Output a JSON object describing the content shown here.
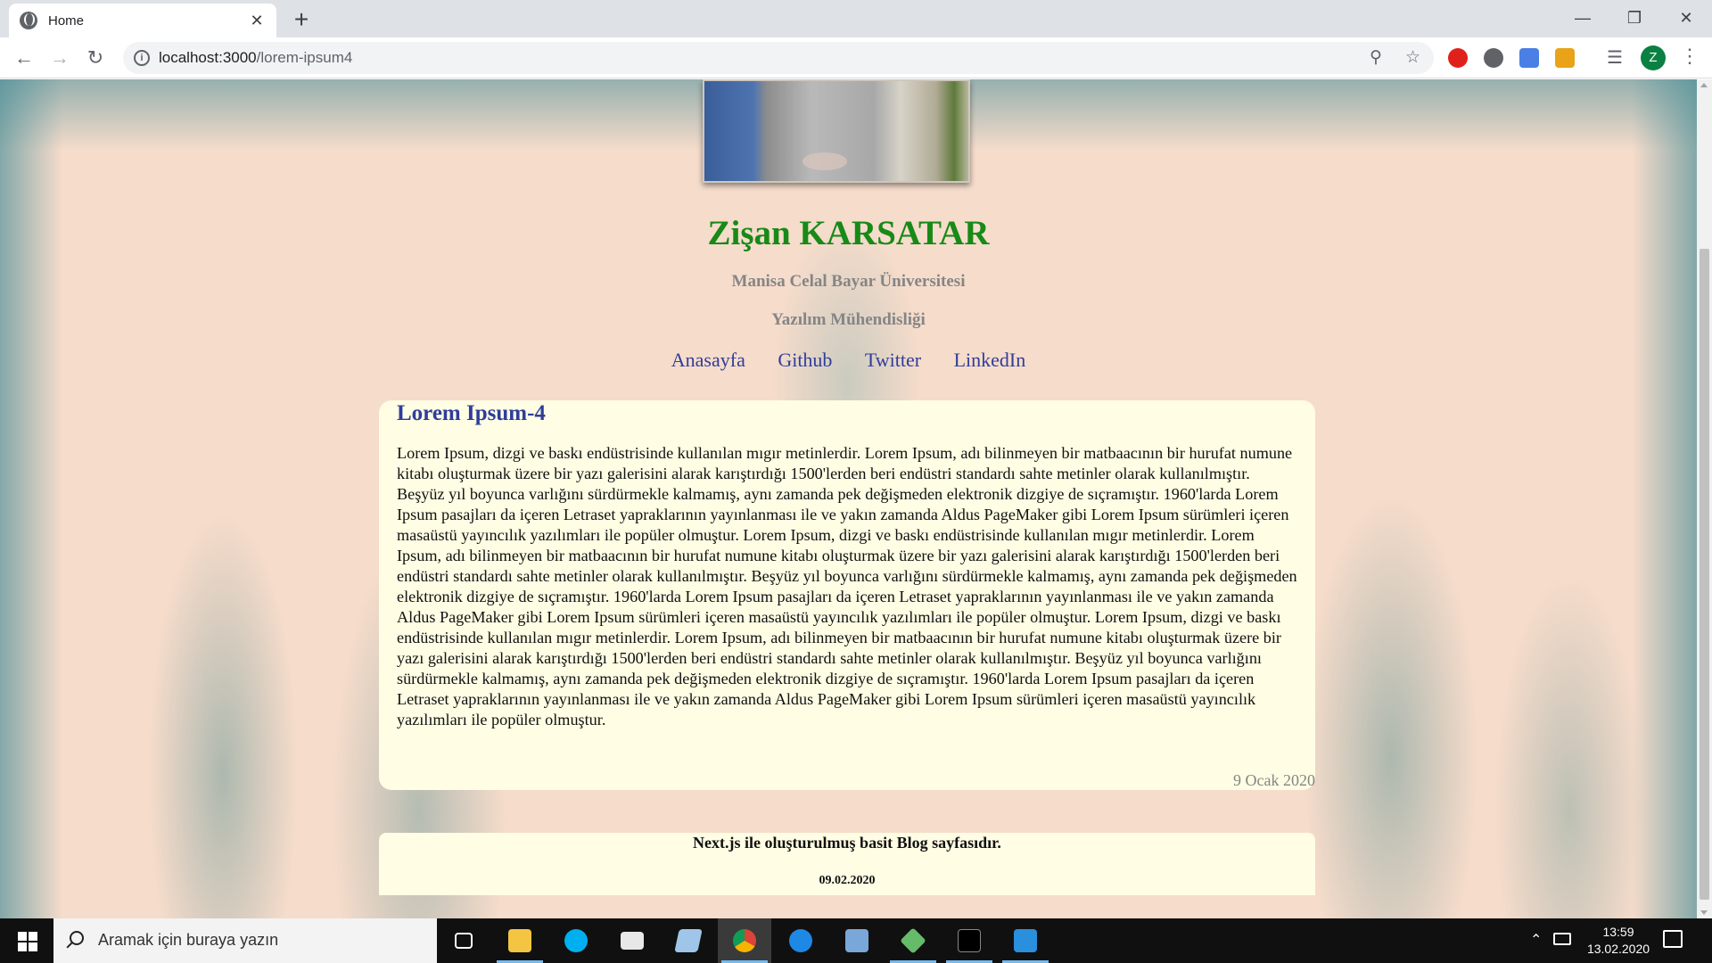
{
  "browser": {
    "tab_title": "Home",
    "url_host": "localhost:3000",
    "url_path": "/lorem-ipsum4",
    "profile_initial": "Z"
  },
  "profile": {
    "name": "Zişan KARSATAR",
    "university": "Manisa Celal Bayar Üniversitesi",
    "department": "Yazılım Mühendisliği"
  },
  "nav": {
    "items": [
      "Anasayfa",
      "Github",
      "Twitter",
      "LinkedIn"
    ]
  },
  "post": {
    "title": "Lorem Ipsum-4",
    "body": "Lorem Ipsum, dizgi ve baskı endüstrisinde kullanılan mıgır metinlerdir. Lorem Ipsum, adı bilinmeyen bir matbaacının bir hurufat numune kitabı oluşturmak üzere bir yazı galerisini alarak karıştırdığı 1500'lerden beri endüstri standardı sahte metinler olarak kullanılmıştır. Beşyüz yıl boyunca varlığını sürdürmekle kalmamış, aynı zamanda pek değişmeden elektronik dizgiye de sıçramıştır. 1960'larda Lorem Ipsum pasajları da içeren Letraset yapraklarının yayınlanması ile ve yakın zamanda Aldus PageMaker gibi Lorem Ipsum sürümleri içeren masaüstü yayıncılık yazılımları ile popüler olmuştur. Lorem Ipsum, dizgi ve baskı endüstrisinde kullanılan mıgır metinlerdir. Lorem Ipsum, adı bilinmeyen bir matbaacının bir hurufat numune kitabı oluşturmak üzere bir yazı galerisini alarak karıştırdığı 1500'lerden beri endüstri standardı sahte metinler olarak kullanılmıştır. Beşyüz yıl boyunca varlığını sürdürmekle kalmamış, aynı zamanda pek değişmeden elektronik dizgiye de sıçramıştır. 1960'larda Lorem Ipsum pasajları da içeren Letraset yapraklarının yayınlanması ile ve yakın zamanda Aldus PageMaker gibi Lorem Ipsum sürümleri içeren masaüstü yayıncılık yazılımları ile popüler olmuştur. Lorem Ipsum, dizgi ve baskı endüstrisinde kullanılan mıgır metinlerdir. Lorem Ipsum, adı bilinmeyen bir matbaacının bir hurufat numune kitabı oluşturmak üzere bir yazı galerisini alarak karıştırdığı 1500'lerden beri endüstri standardı sahte metinler olarak kullanılmıştır. Beşyüz yıl boyunca varlığını sürdürmekle kalmamış, aynı zamanda pek değişmeden elektronik dizgiye de sıçramıştır. 1960'larda Lorem Ipsum pasajları da içeren Letraset yapraklarının yayınlanması ile ve yakın zamanda Aldus PageMaker gibi Lorem Ipsum sürümleri içeren masaüstü yayıncılık yazılımları ile popüler olmuştur.",
    "date": "9 Ocak 2020"
  },
  "footer": {
    "text": "Next.js ile oluşturulmuş basit Blog sayfasıdır.",
    "date": "09.02.2020"
  },
  "taskbar": {
    "search_placeholder": "Aramak için buraya yazın",
    "time": "13:59",
    "date": "13.02.2020"
  },
  "colors": {
    "name_green": "#178a17",
    "link_blue": "#2f3d9a",
    "card_bg": "#fffde4",
    "page_bg": "#f6dccb"
  }
}
